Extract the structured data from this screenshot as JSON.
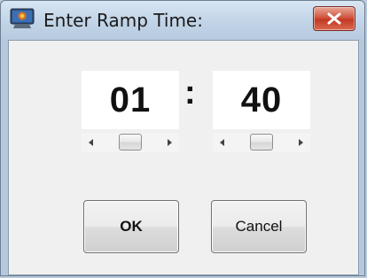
{
  "window": {
    "title": "Enter Ramp Time:",
    "icon": "app-icon",
    "close_icon": "close-icon"
  },
  "time": {
    "hours": "01",
    "separator": ":",
    "minutes": "40",
    "hours_slider_level": 0.5,
    "minutes_slider_level": 0.5
  },
  "buttons": {
    "ok_label": "OK",
    "cancel_label": "Cancel"
  },
  "colors": {
    "close_button": "#c23a24",
    "client_background": "#f0f0f0",
    "title_background": "#c3d5e8"
  }
}
